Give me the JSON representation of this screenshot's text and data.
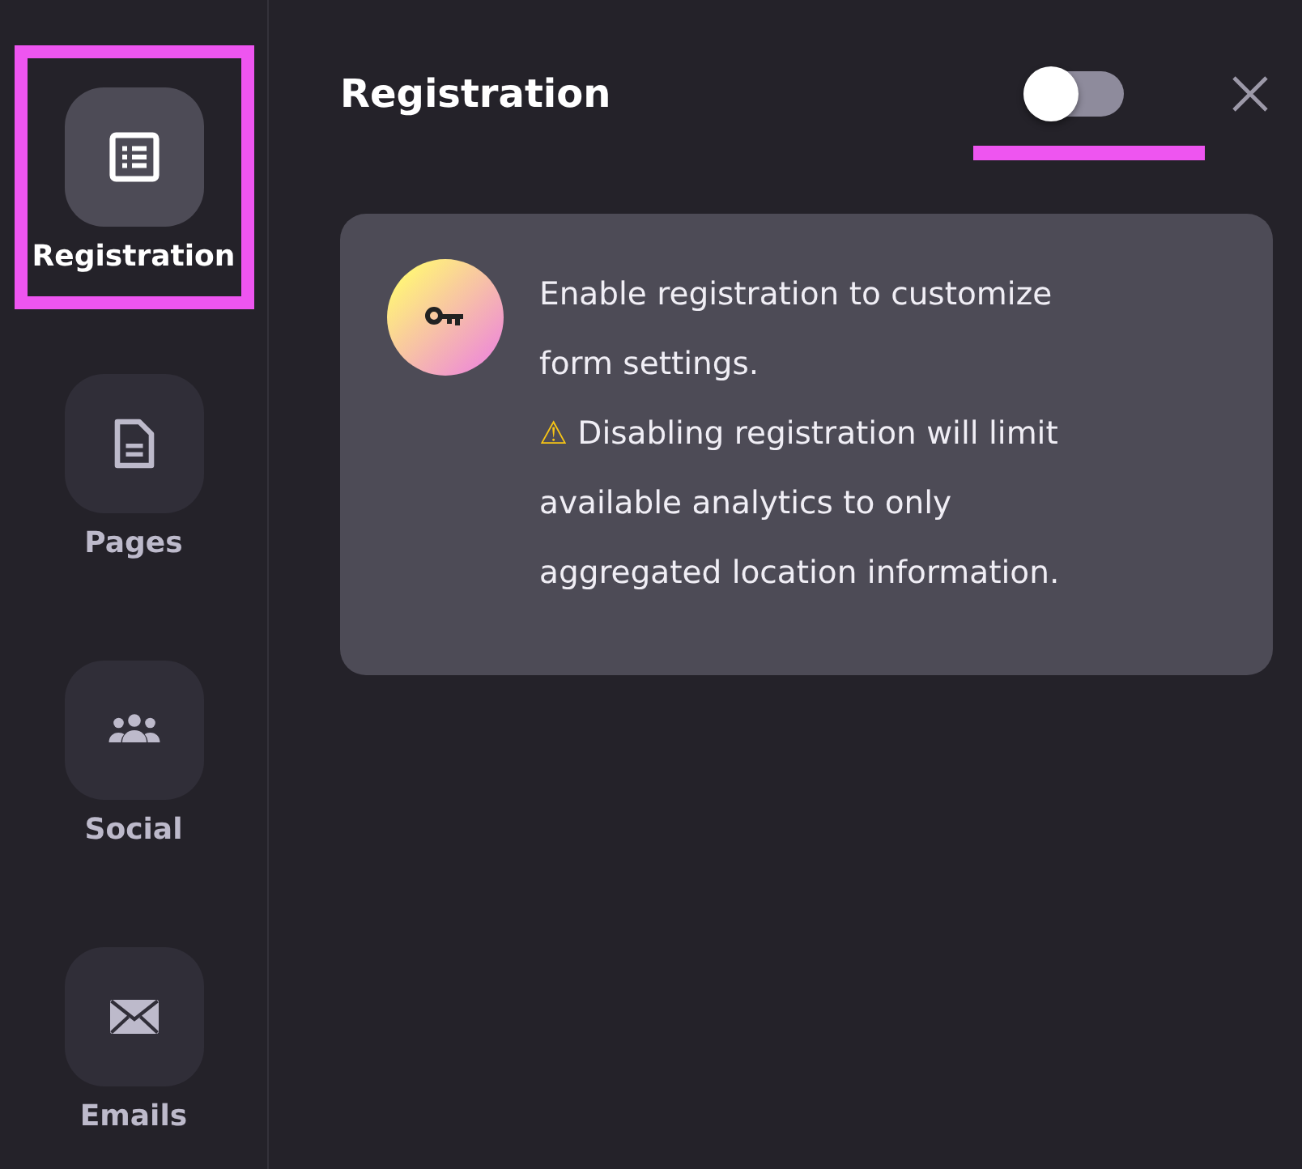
{
  "sidebar": {
    "items": [
      {
        "label": "Registration",
        "selected": true,
        "highlighted": true
      },
      {
        "label": "Pages",
        "selected": false,
        "highlighted": false
      },
      {
        "label": "Social",
        "selected": false,
        "highlighted": false
      },
      {
        "label": "Emails",
        "selected": false,
        "highlighted": false
      }
    ]
  },
  "panel": {
    "title": "Registration",
    "toggle": {
      "on": false,
      "highlighted": true
    },
    "notice": {
      "text": "Enable registration to customize form settings.",
      "warning": "⚠ Disabling registration will limit available analytics to only aggregated location information."
    }
  }
}
